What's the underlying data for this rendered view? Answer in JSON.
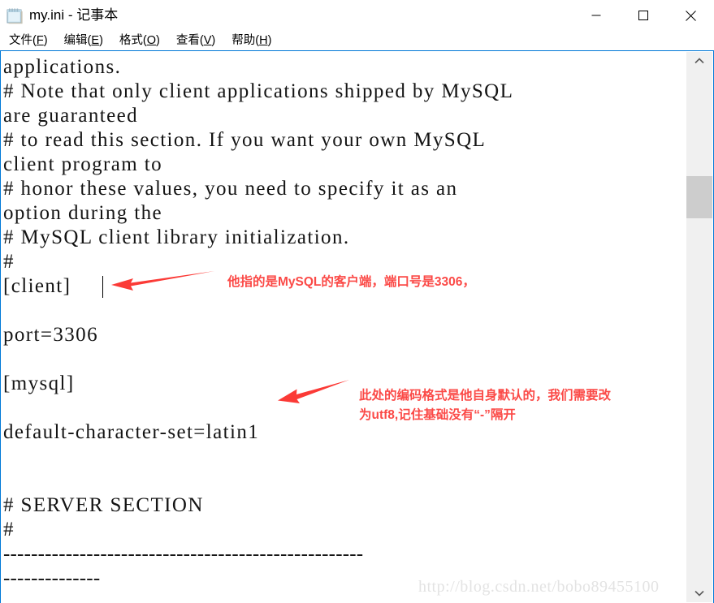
{
  "window": {
    "title": "my.ini - 记事本",
    "app_icon": "notepad-icon",
    "controls": {
      "minimize": "—",
      "maximize": "□",
      "close": "✕"
    }
  },
  "menubar": {
    "items": [
      {
        "label": "文件",
        "mnemonic": "F"
      },
      {
        "label": "编辑",
        "mnemonic": "E"
      },
      {
        "label": "格式",
        "mnemonic": "O"
      },
      {
        "label": "查看",
        "mnemonic": "V"
      },
      {
        "label": "帮助",
        "mnemonic": "H"
      }
    ]
  },
  "editor": {
    "lines": [
      "applications.",
      "# Note that only client applications shipped by MySQL",
      "are guaranteed",
      "# to read this section. If you want your own MySQL",
      "client program to",
      "# honor these values, you need to specify it as an",
      "option during the",
      "# MySQL client library initialization.",
      "#",
      "[client]",
      "",
      "port=3306",
      "",
      "[mysql]",
      "",
      "default-character-set=latin1",
      "",
      "",
      "# SERVER SECTION",
      "#",
      "----------------------------------------------------",
      "--------------"
    ]
  },
  "annotations": [
    {
      "name": "client-section-note",
      "text": "他指的是MySQL的客户端，端口号是3306，",
      "color": "#fb4a47"
    },
    {
      "name": "charset-note-line1",
      "text": "此处的编码格式是他自身默认的，我们需要改",
      "color": "#fb4a47"
    },
    {
      "name": "charset-note-line2",
      "text": "为utf8,记住基础没有“-”隔开",
      "color": "#fb4a47"
    }
  ],
  "watermark": {
    "text": "http://blog.csdn.net/bobo89455100"
  },
  "scrollbar": {
    "up_arrow": "⌃",
    "down_arrow": "⌄"
  },
  "colors": {
    "accent_border": "#0078d7",
    "annotation_red": "#fb4a47",
    "scroll_thumb": "#cdcdcd",
    "scroll_track": "#f0f0f0"
  }
}
